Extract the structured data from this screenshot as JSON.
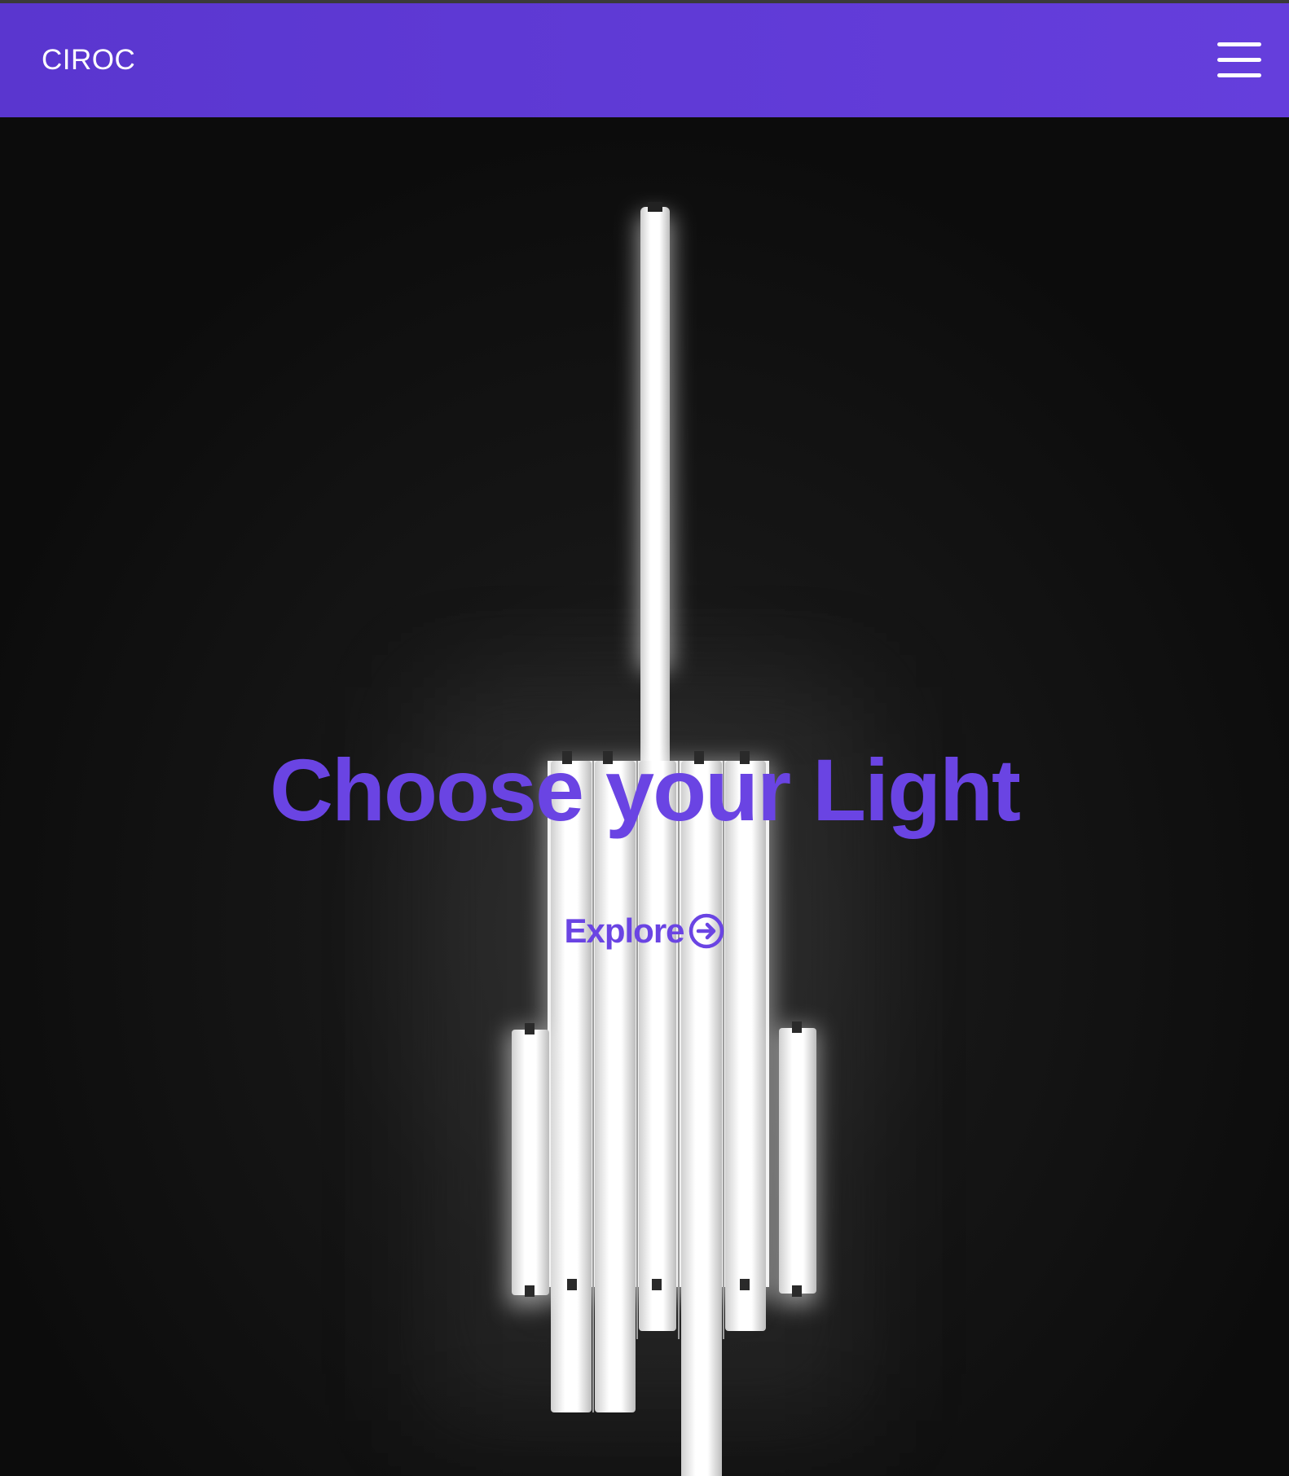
{
  "header": {
    "brand": "CIROC",
    "menu_icon": "hamburger-menu-icon",
    "background_color": "#5f3bd6"
  },
  "hero": {
    "title": "Choose your Light",
    "cta_label": "Explore",
    "cta_icon": "arrow-right-circle-icon",
    "accent_color": "#6a44e3",
    "background_image": "fluorescent-light-tubes"
  }
}
